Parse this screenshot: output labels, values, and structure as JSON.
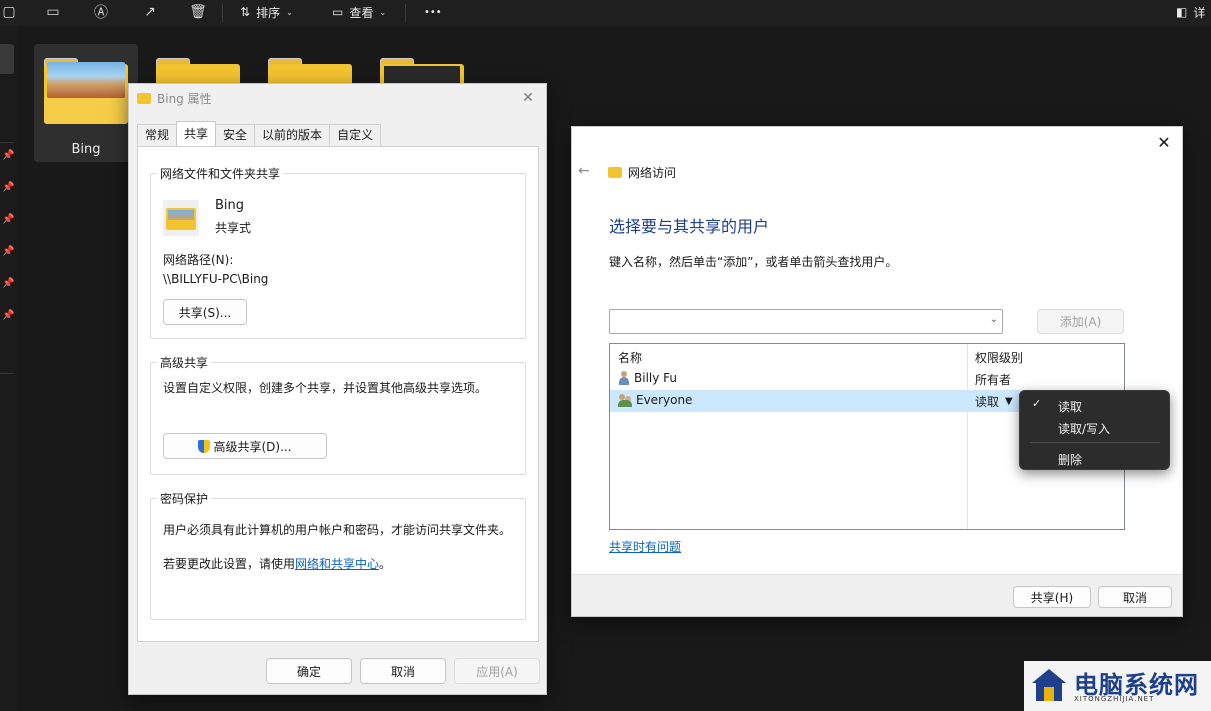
{
  "toolbar": {
    "sort_label": "排序",
    "view_label": "查看",
    "more_label": "•••",
    "details_label": "详"
  },
  "explorer": {
    "files": [
      {
        "label": "Bing"
      }
    ]
  },
  "properties_dialog": {
    "title": "Bing 属性",
    "tabs": [
      "常规",
      "共享",
      "安全",
      "以前的版本",
      "自定义"
    ],
    "active_tab": "共享",
    "network_sharing": {
      "legend": "网络文件和文件夹共享",
      "folder_name": "Bing",
      "share_state": "共享式",
      "network_path_label": "网络路径(N):",
      "network_path": "\\\\BILLYFU-PC\\Bing",
      "share_button": "共享(S)..."
    },
    "advanced_sharing": {
      "legend": "高级共享",
      "description": "设置自定义权限，创建多个共享，并设置其他高级共享选项。",
      "button": "高级共享(D)..."
    },
    "password_protection": {
      "legend": "密码保护",
      "description": "用户必须具有此计算机的用户帐户和密码，才能访问共享文件夹。",
      "change_prefix": "若要更改此设置，请使用",
      "change_link": "网络和共享中心",
      "change_suffix": "。"
    },
    "buttons": {
      "ok": "确定",
      "cancel": "取消",
      "apply": "应用(A)"
    }
  },
  "network_dialog": {
    "title": "网络访问",
    "heading": "选择要与其共享的用户",
    "instruction": "键入名称，然后单击“添加”，或者单击箭头查找用户。",
    "name_input_value": "",
    "add_button": "添加(A)",
    "columns": [
      "名称",
      "权限级别"
    ],
    "users": [
      {
        "name": "Billy Fu",
        "permission": "所有者"
      },
      {
        "name": "Everyone",
        "permission": "读取"
      }
    ],
    "trouble_link": "共享时有问题",
    "share_button": "共享(H)",
    "cancel_button": "取消"
  },
  "permission_menu": {
    "items": [
      {
        "label": "读取",
        "checked": true
      },
      {
        "label": "读取/写入",
        "checked": false
      },
      {
        "label": "删除",
        "checked": false
      }
    ]
  },
  "watermark": {
    "title": "电脑系统网",
    "subtitle": "XITONGZHIJIA.NET"
  }
}
